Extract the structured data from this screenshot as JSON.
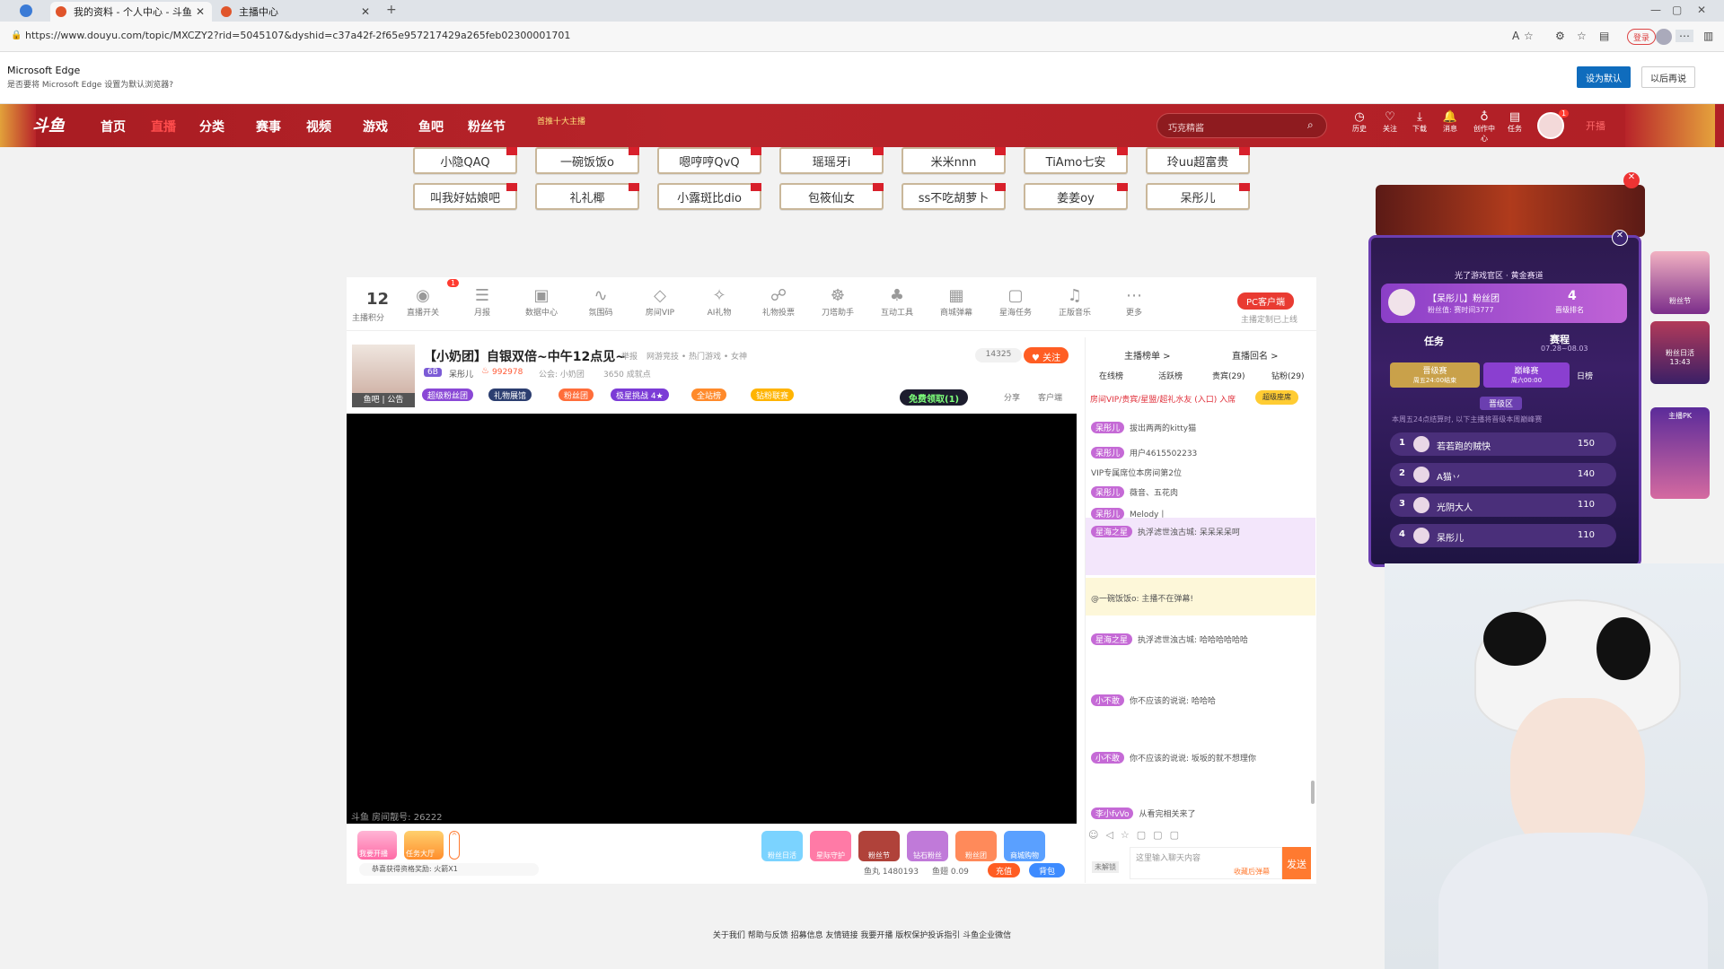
{
  "browser": {
    "tabs": [
      {
        "label": "我的资料 - 个人中心 - 斗鱼",
        "active": true
      },
      {
        "label": "主播中心",
        "active": false
      }
    ],
    "url": "https://www.douyu.com/topic/MXCZY2?rid=5045107&dyshid=c37a42f-2f65e957217429a265feb02300001701",
    "login_label": "登录",
    "infobar": {
      "title": "Microsoft Edge",
      "message": "是否要将 Microsoft Edge 设置为默认浏览器?",
      "set_default": "设为默认",
      "later": "以后再说"
    }
  },
  "nav": {
    "logo": "斗鱼",
    "items": [
      "首页",
      "直播",
      "分类",
      "赛事",
      "视频",
      "游戏",
      "鱼吧",
      "粉丝节"
    ],
    "promo": "首推十大主播",
    "search_placeholder": "巧克精酱",
    "tools": [
      "历史",
      "关注",
      "下载",
      "消息",
      "创作中心",
      "任务"
    ],
    "open_label": "开播",
    "msg_count": "1"
  },
  "anchors_row1": [
    "小隐QAQ",
    "一碗饭饭o",
    "嗯哼哼QvQ",
    "瑶瑶牙i",
    "米米nnn",
    "TiAmo七安",
    "玲uu超富贵"
  ],
  "anchors_row2": [
    "叫我好姑娘吧",
    "礼礼椰",
    "小露斑比dio",
    "包筱仙女",
    "ss不吃胡萝卜",
    "姜姜oy",
    "呆彤儿"
  ],
  "toolbar": {
    "score": "12",
    "score_label": "主播积分",
    "items": [
      "直播开关",
      "月报",
      "数据中心",
      "氛围码",
      "房间VIP",
      "AI礼物",
      "礼物投票",
      "刀塔助手",
      "互动工具",
      "商城弹幕",
      "星海任务",
      "正版音乐",
      "更多"
    ],
    "pc_client": "PC客户端",
    "pc_sub": "主播定制已上线",
    "badge": "1"
  },
  "room": {
    "title": "【小奶团】自银双倍~中午12点见~",
    "report": "举报",
    "category": "网游竞技 • 热门游戏 • 女神",
    "level": "6B",
    "streamer": "呆彤儿",
    "hot": "992978",
    "notice": "公会: 小奶团",
    "fans": "3650 成就点",
    "followers": "14325",
    "follow_btn": "关注",
    "tags": [
      "超级粉丝团",
      "礼物展馆",
      "粉丝团",
      "极星挑战 4★",
      "全站榜",
      "钻粉联赛"
    ],
    "free_btn": "免费领取(1)",
    "share": "分享",
    "client": "客户端",
    "room_no": "斗鱼 房间靓号: 26222",
    "avatar_labels": "鱼吧 | 公告"
  },
  "bottom_bar": {
    "left_items": [
      "我要开播",
      "任务大厅"
    ],
    "gifts": [
      "粉丝日活",
      "星际守护",
      "粉丝节",
      "钻石粉丝",
      "粉丝团",
      "商城购物"
    ],
    "ticker": "恭喜获得资格奖励: 火箭X1",
    "fish_balls": "鱼丸 1480193",
    "fish_fin": "鱼翅 0.09",
    "recharge": "充值",
    "backpack": "背包"
  },
  "chat": {
    "tabs_top": [
      "主播榜单 >",
      "直播回名 >"
    ],
    "tabs": [
      "在线榜",
      "活跃榜",
      "贵宾(29)",
      "钻粉(29)"
    ],
    "vip_notice": "房间VIP/贵宾/星盟/超礼水友 (入口) 入席",
    "vip_btn": "超级座席",
    "lines": [
      {
        "user": "呆彤儿",
        "text": "拔出两两的kitty猫"
      },
      {
        "user": "呆彤儿",
        "text": "用户4615502233"
      },
      {
        "user": "",
        "text": "VIP专属席位本房间第2位"
      },
      {
        "user": "呆彤儿",
        "text": "薇音、五花肉"
      },
      {
        "user": "呆彤儿",
        "text": "Melody丨"
      },
      {
        "user": "星海之星",
        "text": "执浮滤世浊古城: 呆呆呆呆呵"
      },
      {
        "user": "",
        "text": "@一碗饭饭o: 主播不在弹幕!"
      },
      {
        "user": "星海之星",
        "text": "执浮滤世浊古城: 哈哈哈哈哈哈"
      },
      {
        "user": "小不敢",
        "text": "你不应该的说说: 哈哈哈"
      },
      {
        "user": "小不敢",
        "text": "你不应该的说说: 坂坂的就不想理你"
      },
      {
        "user": "李小fvVo",
        "text": "从看完相关来了"
      }
    ],
    "input_placeholder": "这里输入聊天内容",
    "input_hint": "收藏后弹幕",
    "send": "发送",
    "send_level": "未解锁"
  },
  "event": {
    "subtitle": "光了游戏官区 · 黄金赛道",
    "fan_group": "【呆彤儿】粉丝团",
    "fan_info": "粉丝值: 赛时间3777",
    "rank_num": "4",
    "rank_label": "晋级排名",
    "tab_task": "任务",
    "tab_race": "赛程",
    "race_date": "07.28~08.03",
    "stage1": "晋级赛",
    "stage1_sub": "周五24:00结束",
    "stage2": "巅峰赛",
    "stage2_sub": "周六00:00",
    "daily": "日榜",
    "zone": "晋级区",
    "notice": "本周五24点结算时, 以下主播将晋级本周巅峰赛",
    "ranks": [
      {
        "n": "1",
        "name": "若若跑的贼快",
        "score": "150"
      },
      {
        "n": "2",
        "name": "A猫丷",
        "score": "140"
      },
      {
        "n": "3",
        "name": "光阴大人",
        "score": "110"
      },
      {
        "n": "4",
        "name": "呆彤儿",
        "score": "110"
      }
    ],
    "side_badges": [
      "粉丝节",
      "粉丝日活",
      "主播PK"
    ],
    "side_time": "13:43"
  },
  "footer": "关于我们 帮助与反馈 招募信息 友情链接 我要开播 版权保护投诉指引 斗鱼企业微信"
}
